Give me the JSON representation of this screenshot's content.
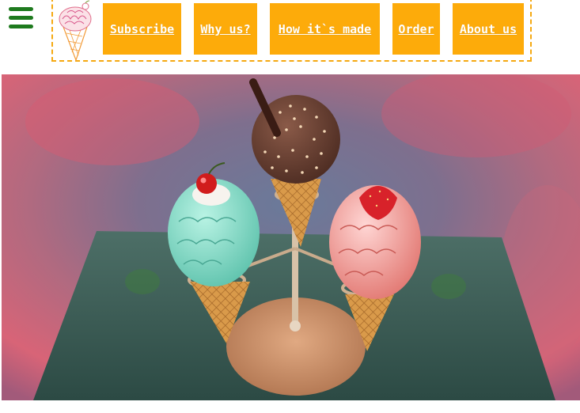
{
  "nav": {
    "menu_icon": "hamburger-menu-icon",
    "logo_icon": "ice-cream-cone-logo-icon",
    "items": [
      {
        "label": "Subscribe"
      },
      {
        "label": "Why us?"
      },
      {
        "label": "How it`s made"
      },
      {
        "label": "Order"
      },
      {
        "label": "About us"
      }
    ]
  },
  "hero": {
    "image_icon": "ice-cream-cones-photo"
  },
  "colors": {
    "accent_orange": "#fdab0a",
    "menu_green": "#1e7a1e",
    "dashed_border": "#f5a911"
  }
}
